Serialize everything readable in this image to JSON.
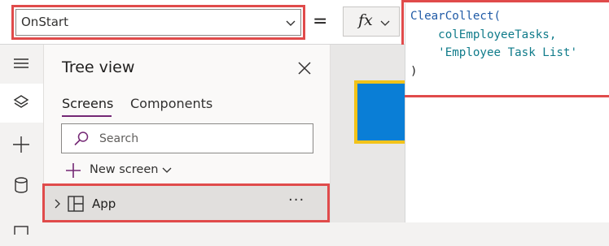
{
  "formula_bar": {
    "property_value": "OnStart",
    "equals_sign": "=",
    "fx_label": "fx"
  },
  "code": {
    "line1_fn": "ClearCollect(",
    "line2_indent": "    ",
    "line2_arg": "colEmployeeTasks,",
    "line3_indent": "    ",
    "line3_arg": "'Employee Task List'",
    "line4": ")"
  },
  "left_rail": {
    "items": [
      "hamburger-icon",
      "layers-icon",
      "plus-icon",
      "database-icon",
      "media-icon"
    ]
  },
  "tree_view": {
    "title": "Tree view",
    "tabs": [
      {
        "label": "Screens",
        "active": true
      },
      {
        "label": "Components",
        "active": false
      }
    ],
    "search_placeholder": "Search",
    "new_screen_label": "New screen",
    "items": [
      {
        "label": "App",
        "more": "···"
      }
    ]
  },
  "colors": {
    "highlight_red": "#e04b4b",
    "accent_purple": "#742774",
    "canvas_blue": "#0a7ed6",
    "canvas_border_yellow": "#f2c31a"
  }
}
